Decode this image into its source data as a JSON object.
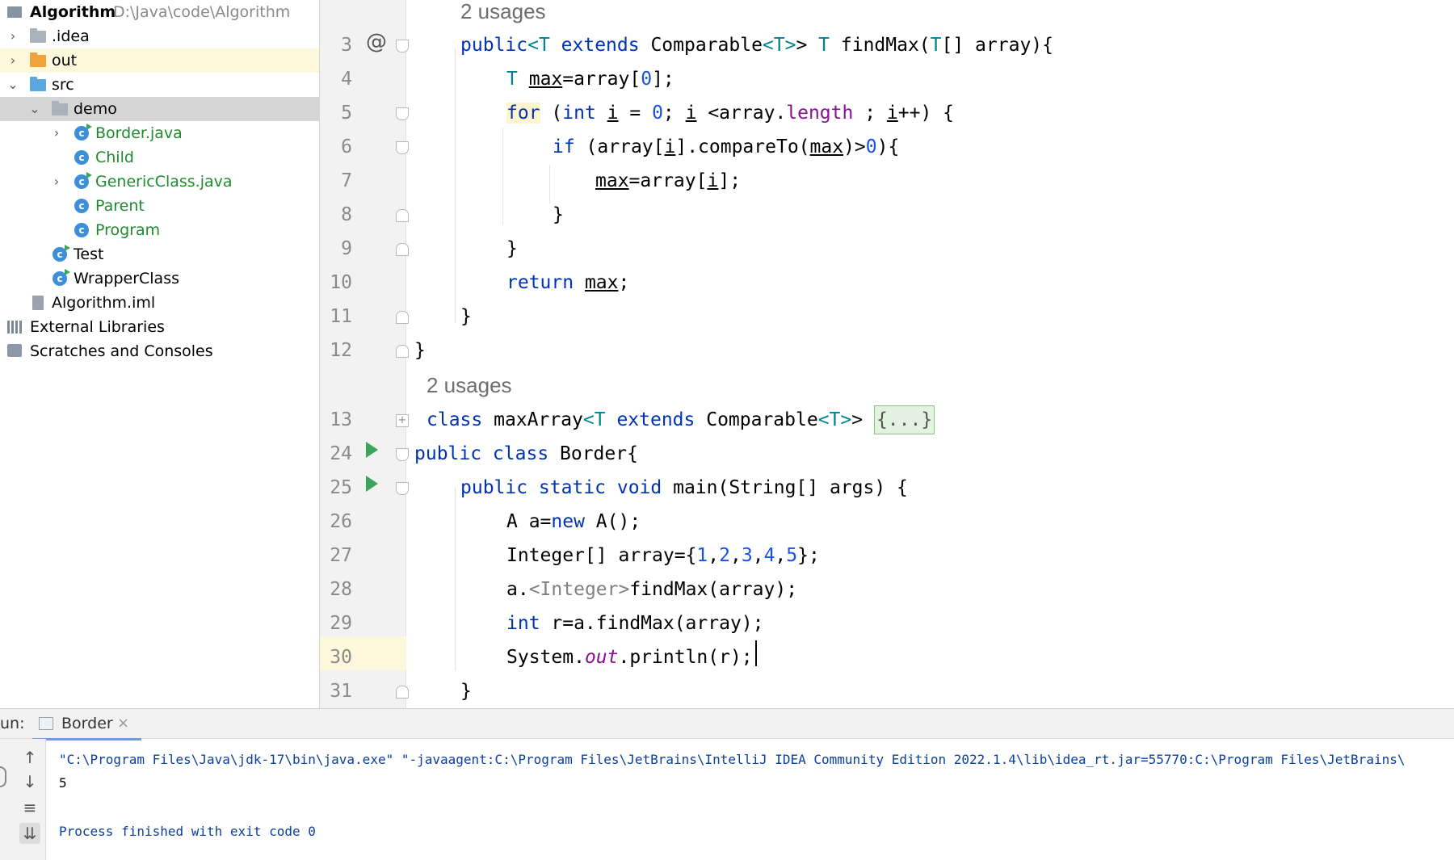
{
  "project": {
    "name": "Algorithm",
    "path": "D:\\Java\\code\\Algorithm",
    "items": [
      {
        "label": ".idea"
      },
      {
        "label": "out"
      },
      {
        "label": "src"
      },
      {
        "label": "demo"
      },
      {
        "label": "Border.java"
      },
      {
        "label": "Child"
      },
      {
        "label": "GenericClass.java"
      },
      {
        "label": "Parent"
      },
      {
        "label": "Program"
      },
      {
        "label": "Test"
      },
      {
        "label": "WrapperClass"
      },
      {
        "label": "Algorithm.iml"
      },
      {
        "label": "External Libraries"
      },
      {
        "label": "Scratches and Consoles"
      }
    ]
  },
  "editor": {
    "usages_label": "2 usages",
    "line_numbers": [
      "3",
      "4",
      "5",
      "6",
      "7",
      "8",
      "9",
      "10",
      "11",
      "12",
      "13",
      "24",
      "25",
      "26",
      "27",
      "28",
      "29",
      "30",
      "31"
    ],
    "at_marker": "@",
    "folded_placeholder": "{...}"
  },
  "run": {
    "label": "un:",
    "tab_label": "Border",
    "command": "\"C:\\Program Files\\Java\\jdk-17\\bin\\java.exe\" \"-javaagent:C:\\Program Files\\JetBrains\\IntelliJ IDEA Community Edition 2022.1.4\\lib\\idea_rt.jar=55770:C:\\Program Files\\JetBrains\\",
    "output": "5",
    "exit_message": "Process finished with exit code 0"
  }
}
